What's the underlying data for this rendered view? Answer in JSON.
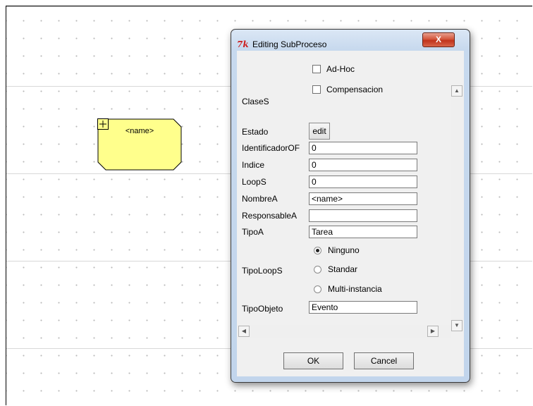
{
  "canvas": {
    "subprocess": {
      "name": "<name>",
      "expand_symbol": "+"
    }
  },
  "dialog": {
    "title": "Editing SubProceso",
    "close_label": "X",
    "fields": {
      "clases_label": "ClaseS",
      "adhoc_label": "Ad-Hoc",
      "compensacion_label": "Compensacion",
      "estado_label": "Estado",
      "edit_label": "edit",
      "identificador_label": "IdentificadorOF",
      "identificador_value": "0",
      "indice_label": "Indice",
      "indice_value": "0",
      "loops_label": "LoopS",
      "loops_value": "0",
      "nombre_label": "NombreA",
      "nombre_value": "<name>",
      "responsable_label": "ResponsableA",
      "responsable_value": "",
      "tipoa_label": "TipoA",
      "tipoa_value": "Tarea",
      "tipoloops_label": "TipoLoopS",
      "tipoloops_options": [
        "Ninguno",
        "Standar",
        "Multi-instancia"
      ],
      "tipoloops_selected": "Ninguno",
      "tipoobjeto_label": "TipoObjeto",
      "tipoobjeto_value": "Evento"
    },
    "buttons": {
      "ok": "OK",
      "cancel": "Cancel"
    }
  }
}
